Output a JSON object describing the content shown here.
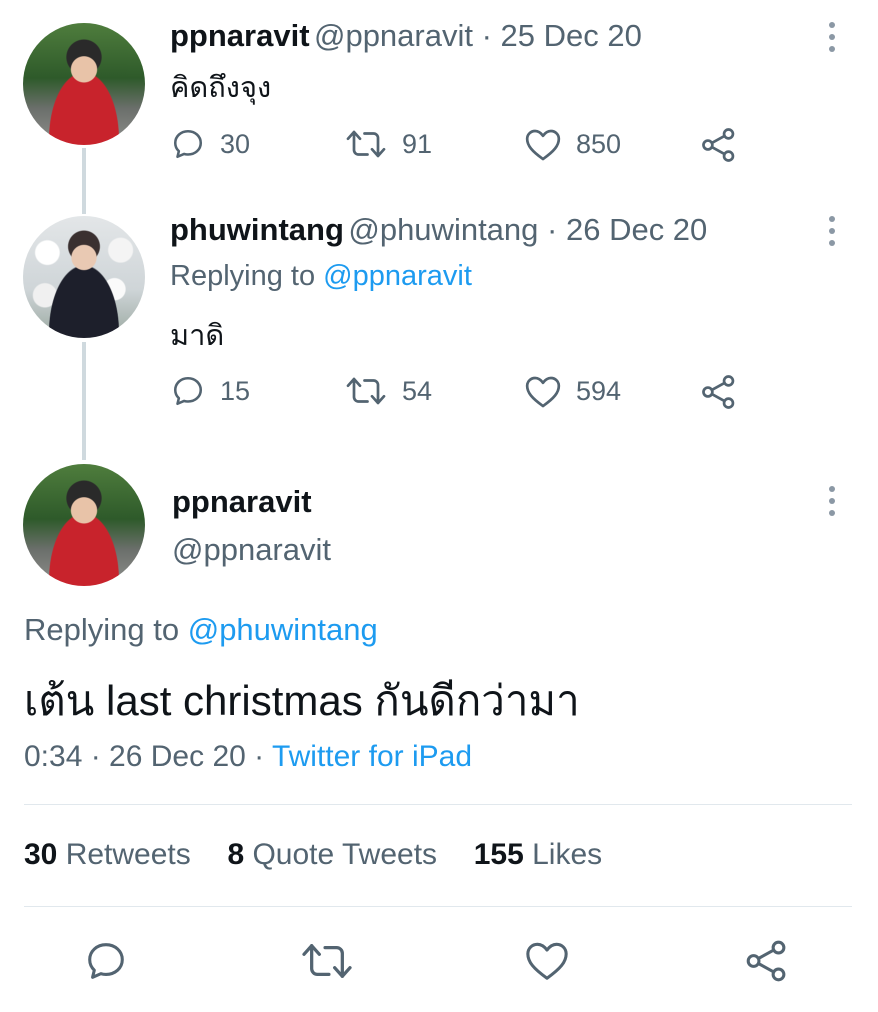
{
  "tweets": [
    {
      "name": "ppnaravit",
      "handle": "@ppnaravit",
      "date_sep": " · ",
      "date": "25 Dec 20",
      "text": "คิดถึงจุง",
      "replies": "30",
      "retweets": "91",
      "likes": "850"
    },
    {
      "name": "phuwintang",
      "handle": "@phuwintang",
      "date_sep": " · ",
      "date": "26 Dec 20",
      "replying_prefix": "Replying to ",
      "replying_to": "@ppnaravit",
      "text": "มาดิ",
      "replies": "15",
      "retweets": "54",
      "likes": "594"
    }
  ],
  "main_tweet": {
    "name": "ppnaravit",
    "handle": "@ppnaravit",
    "replying_prefix": "Replying to ",
    "replying_to": "@phuwintang",
    "text": "เต้น last christmas กันดีกว่ามา",
    "time": "0:34 · 26 Dec 20 · ",
    "source": "Twitter for iPad",
    "retweets_count": "30",
    "retweets_label": " Retweets",
    "quotes_count": "8",
    "quotes_label": " Quote Tweets",
    "likes_count": "155",
    "likes_label": " Likes"
  },
  "icons": [
    "reply-icon",
    "retweet-icon",
    "like-icon",
    "share-icon",
    "more-options-icon"
  ],
  "colors": {
    "link": "#1d9bf0",
    "secondary_text": "#536471",
    "primary_text": "#0f1419",
    "divider": "#e1e8ed",
    "thread_line": "#cfd9de"
  }
}
